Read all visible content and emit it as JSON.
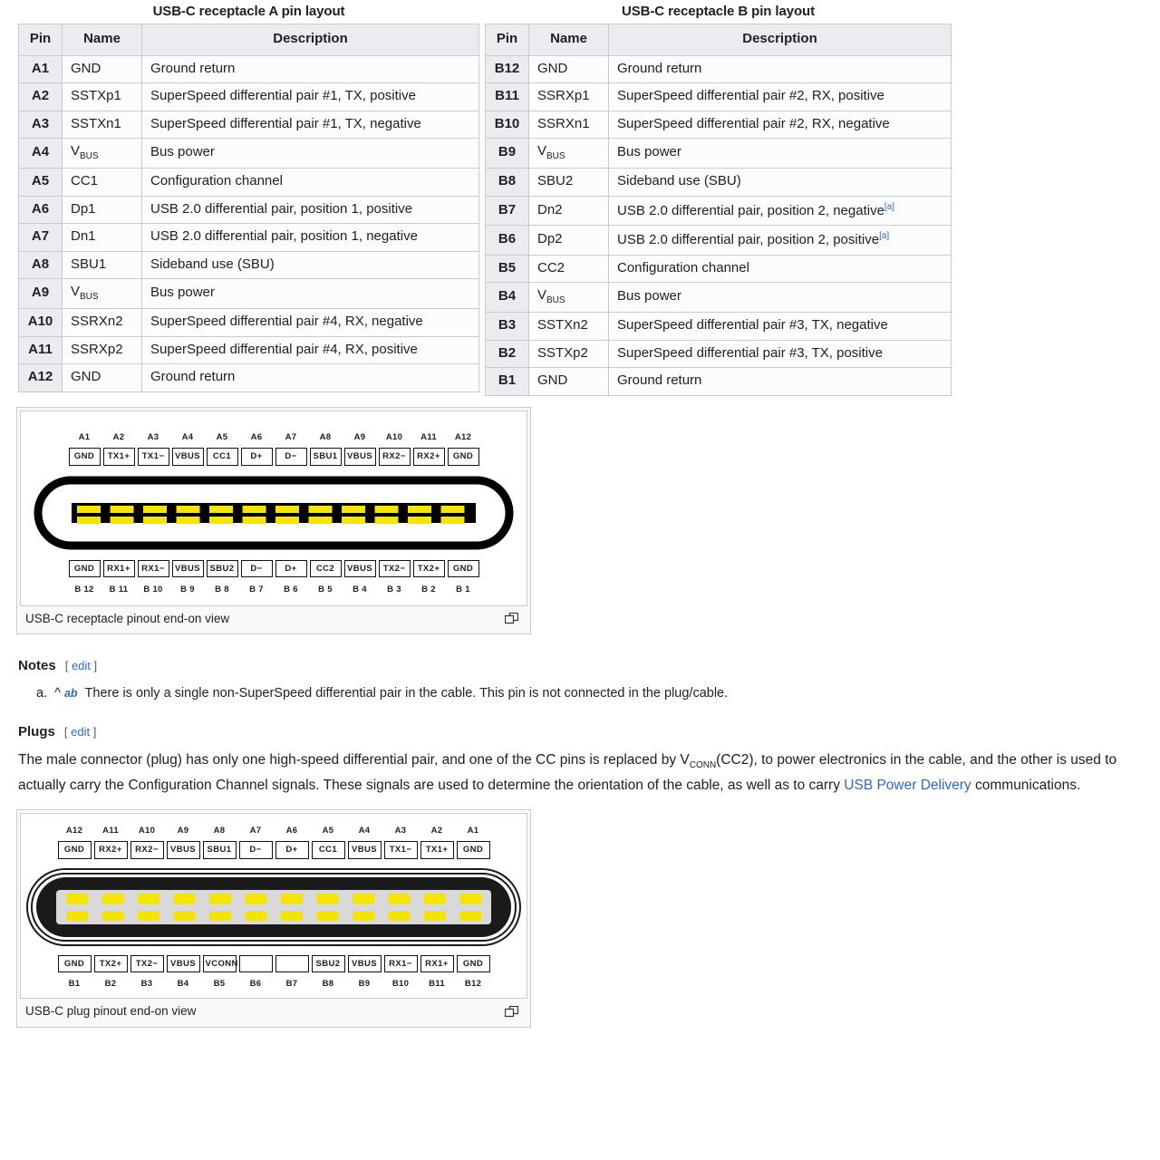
{
  "tables": {
    "columns": [
      "Pin",
      "Name",
      "Description"
    ],
    "a": {
      "title": "USB-C receptacle A pin layout",
      "rows": [
        {
          "pin": "A1",
          "name": "GND",
          "desc": "Ground return"
        },
        {
          "pin": "A2",
          "name": "SSTXp1",
          "desc": "SuperSpeed differential pair #1, TX, positive"
        },
        {
          "pin": "A3",
          "name": "SSTXn1",
          "desc": "SuperSpeed differential pair #1, TX, negative"
        },
        {
          "pin": "A4",
          "name": "VBUS",
          "name_sub": "BUS",
          "name_base": "V",
          "desc": "Bus power"
        },
        {
          "pin": "A5",
          "name": "CC1",
          "desc": "Configuration channel"
        },
        {
          "pin": "A6",
          "name": "Dp1",
          "desc": "USB 2.0 differential pair, position 1, positive"
        },
        {
          "pin": "A7",
          "name": "Dn1",
          "desc": "USB 2.0 differential pair, position 1, negative"
        },
        {
          "pin": "A8",
          "name": "SBU1",
          "desc": "Sideband use (SBU)"
        },
        {
          "pin": "A9",
          "name": "VBUS",
          "name_sub": "BUS",
          "name_base": "V",
          "desc": "Bus power"
        },
        {
          "pin": "A10",
          "name": "SSRXn2",
          "desc": "SuperSpeed differential pair #4, RX, negative"
        },
        {
          "pin": "A11",
          "name": "SSRXp2",
          "desc": "SuperSpeed differential pair #4, RX, positive"
        },
        {
          "pin": "A12",
          "name": "GND",
          "desc": "Ground return"
        }
      ]
    },
    "b": {
      "title": "USB-C receptacle B pin layout",
      "rows": [
        {
          "pin": "B12",
          "name": "GND",
          "desc": "Ground return"
        },
        {
          "pin": "B11",
          "name": "SSRXp1",
          "desc": "SuperSpeed differential pair #2, RX, positive"
        },
        {
          "pin": "B10",
          "name": "SSRXn1",
          "desc": "SuperSpeed differential pair #2, RX, negative"
        },
        {
          "pin": "B9",
          "name": "VBUS",
          "name_sub": "BUS",
          "name_base": "V",
          "desc": "Bus power"
        },
        {
          "pin": "B8",
          "name": "SBU2",
          "desc": "Sideband use (SBU)"
        },
        {
          "pin": "B7",
          "name": "Dn2",
          "desc": "USB 2.0 differential pair, position 2, negative",
          "note": "[a]"
        },
        {
          "pin": "B6",
          "name": "Dp2",
          "desc": "USB 2.0 differential pair, position 2, positive",
          "note": "[a]"
        },
        {
          "pin": "B5",
          "name": "CC2",
          "desc": "Configuration channel"
        },
        {
          "pin": "B4",
          "name": "VBUS",
          "name_sub": "BUS",
          "name_base": "V",
          "desc": "Bus power"
        },
        {
          "pin": "B3",
          "name": "SSTXn2",
          "desc": "SuperSpeed differential pair #3, TX, negative"
        },
        {
          "pin": "B2",
          "name": "SSTXp2",
          "desc": "SuperSpeed differential pair #3, TX, positive"
        },
        {
          "pin": "B1",
          "name": "GND",
          "desc": "Ground return"
        }
      ]
    }
  },
  "receptacle_figure": {
    "caption": "USB-C receptacle pinout end-on view",
    "top_refs": [
      "A1",
      "A2",
      "A3",
      "A4",
      "A5",
      "A6",
      "A7",
      "A8",
      "A9",
      "A10",
      "A11",
      "A12"
    ],
    "top_labels": [
      "GND",
      "TX1+",
      "TX1−",
      "VBUS",
      "CC1",
      "D+",
      "D−",
      "SBU1",
      "VBUS",
      "RX2−",
      "RX2+",
      "GND"
    ],
    "bottom_labels": [
      "GND",
      "RX1+",
      "RX1−",
      "VBUS",
      "SBU2",
      "D−",
      "D+",
      "CC2",
      "VBUS",
      "TX2−",
      "TX2+",
      "GND"
    ],
    "bottom_refs": [
      "B 12",
      "B 11",
      "B 10",
      "B 9",
      "B 8",
      "B 7",
      "B 6",
      "B 5",
      "B 4",
      "B 3",
      "B 2",
      "B 1"
    ],
    "pin_count": 12,
    "colors": {
      "pin": "#f5e400",
      "shell": "#000000",
      "tongue": "#000000",
      "cavity": "#ffffff"
    }
  },
  "plug_figure": {
    "caption": "USB-C plug pinout end-on view",
    "top_refs": [
      "A12",
      "A11",
      "A10",
      "A9",
      "A8",
      "A7",
      "A6",
      "A5",
      "A4",
      "A3",
      "A2",
      "A1"
    ],
    "top_labels": [
      "GND",
      "RX2+",
      "RX2−",
      "VBUS",
      "SBU1",
      "D−",
      "D+",
      "CC1",
      "VBUS",
      "TX1−",
      "TX1+",
      "GND"
    ],
    "bottom_labels": [
      "GND",
      "TX2+",
      "TX2−",
      "VBUS",
      "VCONN",
      "",
      "",
      "SBU2",
      "VBUS",
      "RX1−",
      "RX1+",
      "GND"
    ],
    "bottom_refs": [
      "B1",
      "B2",
      "B3",
      "B4",
      "B5",
      "B6",
      "B7",
      "B8",
      "B9",
      "B10",
      "B11",
      "B12"
    ],
    "pin_count": 12,
    "colors": {
      "pin": "#f5e400",
      "shell": "#1a1a1a",
      "tongue": "#d9d9d9"
    }
  },
  "notes_section": {
    "heading": "Notes",
    "edit_open": "[",
    "edit_label": "edit",
    "edit_close": "]",
    "items": [
      {
        "marker": "a.",
        "caret": "^",
        "backrefs": [
          "a",
          "b"
        ],
        "text": "There is only a single non-SuperSpeed differential pair in the cable. This pin is not connected in the plug/cable."
      }
    ]
  },
  "plugs_section": {
    "heading": "Plugs",
    "edit_open": "[",
    "edit_label": "edit",
    "edit_close": "]",
    "paragraph": {
      "part1": "The male connector (plug) has only one high-speed differential pair, and one of the CC pins is replaced by V",
      "vconn_sub": "CONN",
      "part2": "(CC2), to power electronics in the cable, and the other is used to actually carry the Configuration Channel signals. These signals are used to determine the orientation of the cable, as well as to carry ",
      "link": "USB Power Delivery",
      "part3": " communications."
    }
  }
}
